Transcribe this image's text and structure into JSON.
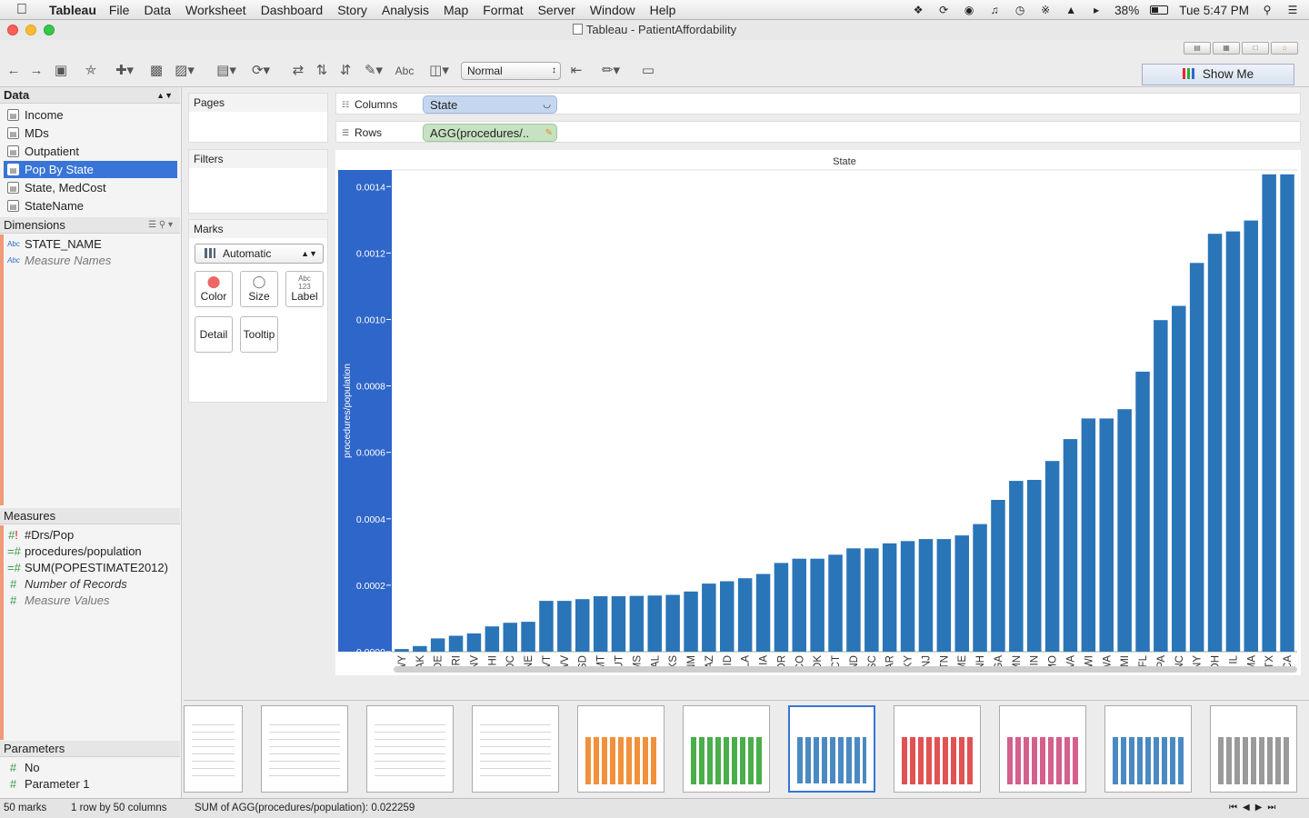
{
  "menubar": {
    "app": "Tableau",
    "items": [
      "File",
      "Data",
      "Worksheet",
      "Dashboard",
      "Story",
      "Analysis",
      "Map",
      "Format",
      "Server",
      "Window",
      "Help"
    ],
    "battery": "38%",
    "clock": "Tue 5:47 PM"
  },
  "window": {
    "title": "Tableau - PatientAffordability"
  },
  "toolbar": {
    "abc_label": "Abc",
    "fit": "Normal",
    "show_me": "Show Me"
  },
  "data_pane": {
    "header": "Data",
    "sources": [
      "Income",
      "MDs",
      "Outpatient",
      "Pop By State",
      "State, MedCost",
      "StateName"
    ],
    "selected_source": "Pop By State",
    "dimensions_header": "Dimensions",
    "dimensions": [
      {
        "label": "STATE_NAME",
        "italic": false
      },
      {
        "label": "Measure Names",
        "italic": true
      }
    ],
    "measures_header": "Measures",
    "measures": [
      {
        "label": "#Drs/Pop",
        "italic": false
      },
      {
        "label": "procedures/population",
        "italic": false
      },
      {
        "label": "SUM(POPESTIMATE2012)",
        "italic": false
      },
      {
        "label": "Number of Records",
        "italic": true
      },
      {
        "label": "Measure Values",
        "italic": true
      }
    ],
    "parameters_header": "Parameters",
    "parameters": [
      "No",
      "Parameter 1"
    ]
  },
  "cards": {
    "pages": "Pages",
    "filters": "Filters",
    "marks": "Marks",
    "mark_type": "Automatic",
    "buttons": [
      "Color",
      "Size",
      "Label",
      "Detail",
      "Tooltip"
    ],
    "label_glyph": "Abc 123"
  },
  "shelves": {
    "columns_label": "Columns",
    "columns_pill": "State",
    "rows_label": "Rows",
    "rows_pill": "AGG(procedures/.."
  },
  "chart_data": {
    "type": "bar",
    "title": "State",
    "xlabel": "",
    "ylabel": "procedures/population",
    "ylim": [
      0,
      0.00145
    ],
    "yticks": [
      "0.0000",
      "0.0002",
      "0.0004",
      "0.0006",
      "0.0008",
      "0.0010",
      "0.0012",
      "0.0014"
    ],
    "categories": [
      "WY",
      "AK",
      "DE",
      "RI",
      "NV",
      "HI",
      "DC",
      "NE",
      "VT",
      "WV",
      "SD",
      "MT",
      "UT",
      "MS",
      "AL",
      "KS",
      "NM",
      "AZ",
      "ID",
      "LA",
      "IA",
      "OR",
      "CO",
      "OK",
      "CT",
      "ND",
      "SC",
      "AR",
      "KY",
      "NJ",
      "TN",
      "ME",
      "NH",
      "GA",
      "MN",
      "IN",
      "MO",
      "VA",
      "WI",
      "WA",
      "MI",
      "FL",
      "PA",
      "NC",
      "NY",
      "OH",
      "IL",
      "MA",
      "TX",
      "CA"
    ],
    "values": [
      8e-06,
      1.7e-05,
      4e-05,
      4.8e-05,
      5.5e-05,
      7.6e-05,
      8.7e-05,
      9e-05,
      0.000153,
      0.000153,
      0.000158,
      0.000167,
      0.000167,
      0.000168,
      0.000169,
      0.000171,
      0.000181,
      0.000205,
      0.000212,
      0.000221,
      0.000234,
      0.000267,
      0.00028,
      0.00028,
      0.000292,
      0.000311,
      0.000311,
      0.000326,
      0.000333,
      0.000339,
      0.000339,
      0.00035,
      0.000384,
      0.000457,
      0.000514,
      0.000517,
      0.000574,
      0.00064,
      0.000702,
      0.000702,
      0.00073,
      0.000843,
      0.000998,
      0.001041,
      0.00117,
      0.001258,
      0.001265,
      0.001298,
      0.001437,
      0.001437
    ],
    "color": "#2a75b8",
    "grid": false
  },
  "status": {
    "marks": "50 marks",
    "dims": "1 row by 50 columns",
    "sum": "SUM of AGG(procedures/population): 0.022259"
  },
  "filmstrip": {
    "thumbs": 11,
    "selected_index": 6
  }
}
